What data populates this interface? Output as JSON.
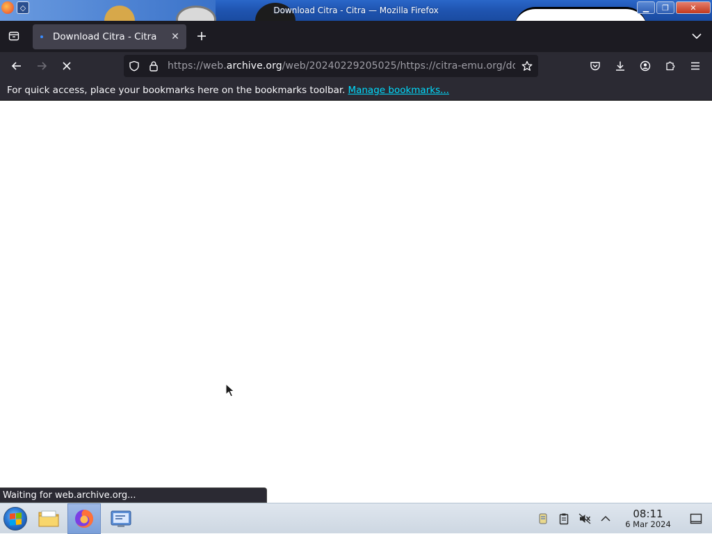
{
  "window": {
    "title": "Download Citra - Citra — Mozilla Firefox",
    "controls": {
      "minimize_icon": "minimize-icon",
      "maximize_icon": "maximize-icon",
      "close_icon": "close-icon"
    }
  },
  "tabs": [
    {
      "label": "Download Citra - Citra",
      "active": true,
      "loading": true
    }
  ],
  "toolbar": {
    "url_prefix": "https://web.",
    "url_domain": "archive.org",
    "url_rest": "/web/20240229205025/https://citra-emu.org/do"
  },
  "bookmarks_bar": {
    "message": "For quick access, place your bookmarks here on the bookmarks toolbar.",
    "link_label": "Manage bookmarks..."
  },
  "status_bar": {
    "text": "Waiting for web.archive.org..."
  },
  "taskbar": {
    "clock_time": "08:11",
    "clock_date": "6 Mar 2024"
  },
  "colors": {
    "tab_strip_bg": "#1c1b22",
    "toolbar_bg": "#2b2a33",
    "active_tab_bg": "#42414d",
    "link": "#00ddff",
    "titlebar": "#1f54b0"
  }
}
